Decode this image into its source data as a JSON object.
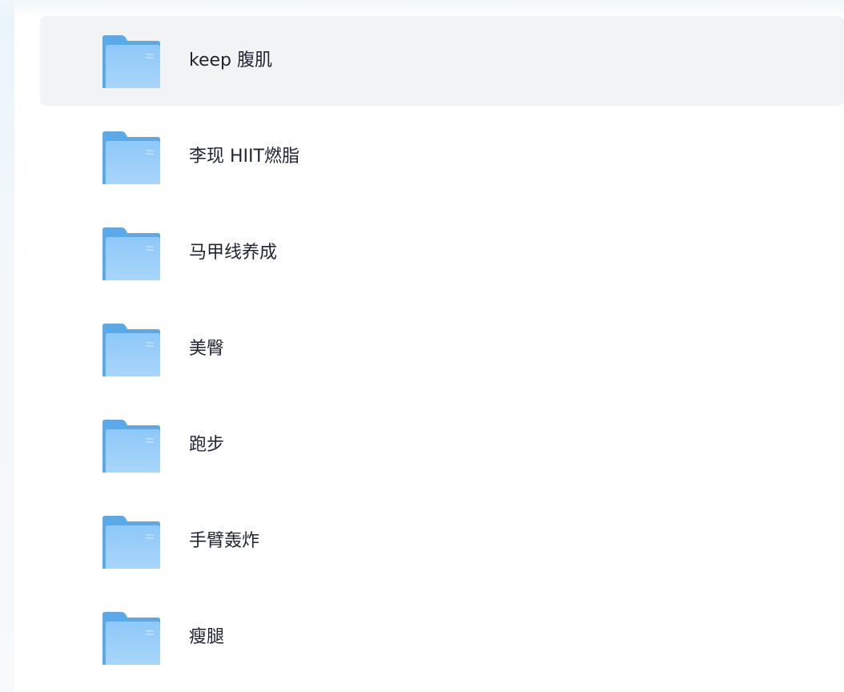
{
  "colors": {
    "selected_row_bg": "#f2f3f5",
    "folder_back": "#5aa9e8",
    "folder_front_top": "#8ec8f7",
    "folder_front_bottom": "#a8d5fb",
    "text": "#1f2430"
  },
  "folders": [
    {
      "name": "keep 腹肌",
      "icon": "folder-icon",
      "selected": true
    },
    {
      "name": "李现 HIIT燃脂",
      "icon": "folder-icon",
      "selected": false
    },
    {
      "name": "马甲线养成",
      "icon": "folder-icon",
      "selected": false
    },
    {
      "name": "美臀",
      "icon": "folder-icon",
      "selected": false
    },
    {
      "name": "跑步",
      "icon": "folder-icon",
      "selected": false
    },
    {
      "name": "手臂轰炸",
      "icon": "folder-icon",
      "selected": false
    },
    {
      "name": "瘦腿",
      "icon": "folder-icon",
      "selected": false
    }
  ]
}
